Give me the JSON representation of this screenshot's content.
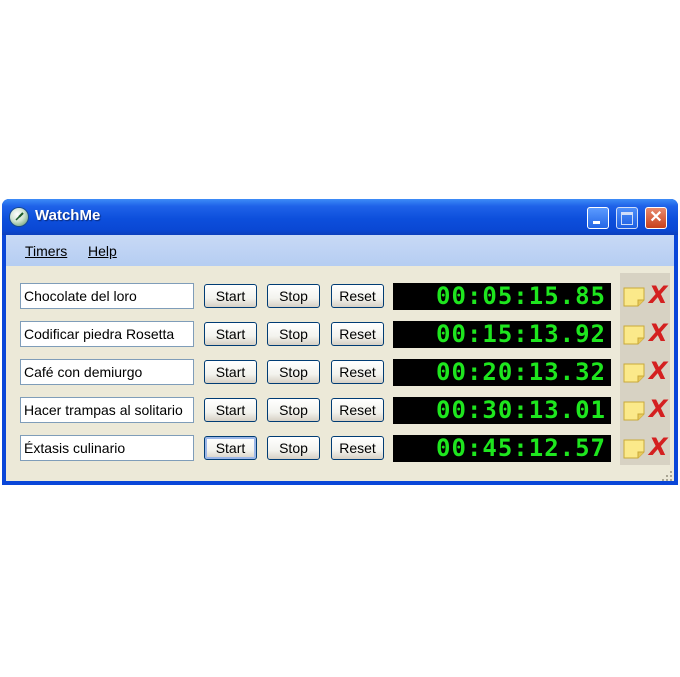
{
  "window": {
    "title": "WatchMe"
  },
  "menu": {
    "timers": "Timers",
    "help": "Help"
  },
  "timers": [
    {
      "name": "Chocolate del loro",
      "start": "Start",
      "stop": "Stop",
      "reset": "Reset",
      "time": "00:05:15.85"
    },
    {
      "name": "Codificar piedra Rosetta",
      "start": "Start",
      "stop": "Stop",
      "reset": "Reset",
      "time": "00:15:13.92"
    },
    {
      "name": "Café con demiurgo",
      "start": "Start",
      "stop": "Stop",
      "reset": "Reset",
      "time": "00:20:13.32"
    },
    {
      "name": "Hacer trampas al solitario",
      "start": "Start",
      "stop": "Stop",
      "reset": "Reset",
      "time": "00:30:13.01"
    },
    {
      "name": "Éxtasis culinario",
      "start": "Start",
      "stop": "Stop",
      "reset": "Reset",
      "time": "00:45:12.57"
    }
  ],
  "icons": {
    "app": "stopwatch-icon",
    "note": "note-icon",
    "delete": "delete-x-icon"
  },
  "colors": {
    "display_text": "#1ee61e",
    "delete": "#d42020",
    "title_bar": "#0a48d4"
  }
}
